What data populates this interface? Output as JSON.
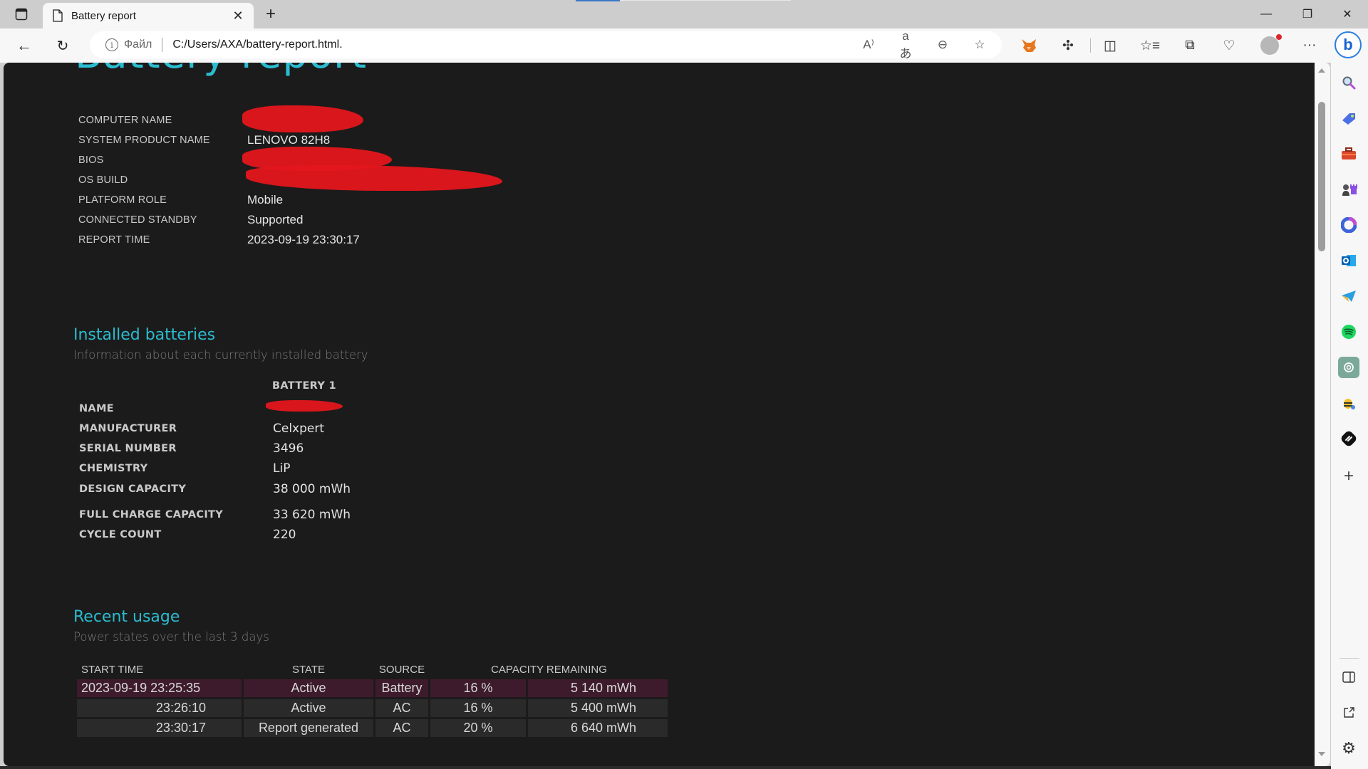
{
  "browser": {
    "tab": {
      "title": "Battery report",
      "icon": "page-icon",
      "close_icon": "close-icon"
    },
    "new_tab_icon": "plus-icon",
    "window_controls": {
      "minimize": "—",
      "restore": "❐",
      "close": "✕"
    },
    "nav": {
      "back": "←",
      "reload": "↻"
    },
    "address": {
      "scheme_label": "Файл",
      "url": "C:/Users/AXA/battery-report.html."
    },
    "address_icons": [
      {
        "name": "read-aloud-icon",
        "glyph": "A⁾"
      },
      {
        "name": "translate-icon",
        "glyph": "aあ"
      },
      {
        "name": "zoom-out-icon",
        "glyph": "⊖"
      },
      {
        "name": "favorite-star-icon",
        "glyph": "☆"
      }
    ],
    "toolbar_icons": [
      {
        "name": "metamask-extension-icon",
        "glyph": "🦊"
      },
      {
        "name": "extensions-icon",
        "glyph": "✣"
      },
      {
        "name": "split-screen-icon",
        "glyph": "◫"
      },
      {
        "name": "favorites-icon",
        "glyph": "☆≡"
      },
      {
        "name": "collections-icon",
        "glyph": "⧉"
      },
      {
        "name": "browser-essentials-icon",
        "glyph": "♡"
      },
      {
        "name": "more-menu-icon",
        "glyph": "···"
      }
    ],
    "bing_label": "b"
  },
  "report": {
    "title": "Battery report",
    "system_info": [
      {
        "label": "COMPUTER NAME",
        "value": "",
        "redacted": true
      },
      {
        "label": "SYSTEM PRODUCT NAME",
        "value": "LENOVO 82H8"
      },
      {
        "label": "BIOS",
        "value": "",
        "redacted": true
      },
      {
        "label": "OS BUILD",
        "value": "",
        "redacted": true
      },
      {
        "label": "PLATFORM ROLE",
        "value": "Mobile"
      },
      {
        "label": "CONNECTED STANDBY",
        "value": "Supported"
      },
      {
        "label": "REPORT TIME",
        "value": "2023-09-19  23:30:17"
      }
    ],
    "installed_batteries": {
      "title": "Installed batteries",
      "subtitle": "Information about each currently installed battery",
      "column_header": "BATTERY 1",
      "rows": [
        {
          "label": "NAME",
          "value": "",
          "redacted": true
        },
        {
          "label": "MANUFACTURER",
          "value": "Celxpert"
        },
        {
          "label": "SERIAL NUMBER",
          "value": "3496"
        },
        {
          "label": "CHEMISTRY",
          "value": "LiP"
        },
        {
          "label": "DESIGN CAPACITY",
          "value": "38 000 mWh"
        },
        {
          "label": "FULL CHARGE CAPACITY",
          "value": "33 620 mWh"
        },
        {
          "label": "CYCLE COUNT",
          "value": "220"
        }
      ]
    },
    "recent_usage": {
      "title": "Recent usage",
      "subtitle": "Power states over the last 3 days",
      "headers": {
        "start_time": "START TIME",
        "state": "STATE",
        "source": "SOURCE",
        "capacity": "CAPACITY REMAINING"
      },
      "rows": [
        {
          "start_time": "2023-09-19  23:25:35",
          "state": "Active",
          "source": "Battery",
          "percent": "16 %",
          "mwh": "5 140 mWh",
          "highlight": true
        },
        {
          "start_time": "23:26:10",
          "state": "Active",
          "source": "AC",
          "percent": "16 %",
          "mwh": "5 400 mWh",
          "highlight": false
        },
        {
          "start_time": "23:30:17",
          "state": "Report generated",
          "source": "AC",
          "percent": "20 %",
          "mwh": "6 640 mWh",
          "highlight": false
        }
      ]
    }
  },
  "sidebar": {
    "items": [
      {
        "name": "sidebar-search-icon",
        "glyph": "🔍"
      },
      {
        "name": "sidebar-shopping-icon",
        "glyph": "🏷"
      },
      {
        "name": "sidebar-tools-icon",
        "glyph": "🧰"
      },
      {
        "name": "sidebar-games-icon",
        "glyph": "♜"
      },
      {
        "name": "sidebar-m365-icon",
        "glyph": "◎"
      },
      {
        "name": "sidebar-outlook-icon",
        "glyph": "O"
      },
      {
        "name": "sidebar-telegram-icon",
        "glyph": "➤"
      },
      {
        "name": "sidebar-spotify-icon",
        "glyph": "≋"
      },
      {
        "name": "sidebar-chatgpt-icon",
        "glyph": "✿"
      },
      {
        "name": "sidebar-bee-icon",
        "glyph": "🐝"
      },
      {
        "name": "sidebar-shazam-icon",
        "glyph": "S"
      },
      {
        "name": "sidebar-add-icon",
        "glyph": "+"
      }
    ],
    "bottom": [
      {
        "name": "sidebar-toggle-icon",
        "glyph": "▯"
      },
      {
        "name": "sidebar-open-external-icon",
        "glyph": "↗"
      },
      {
        "name": "sidebar-settings-icon",
        "glyph": "⚙"
      }
    ]
  }
}
